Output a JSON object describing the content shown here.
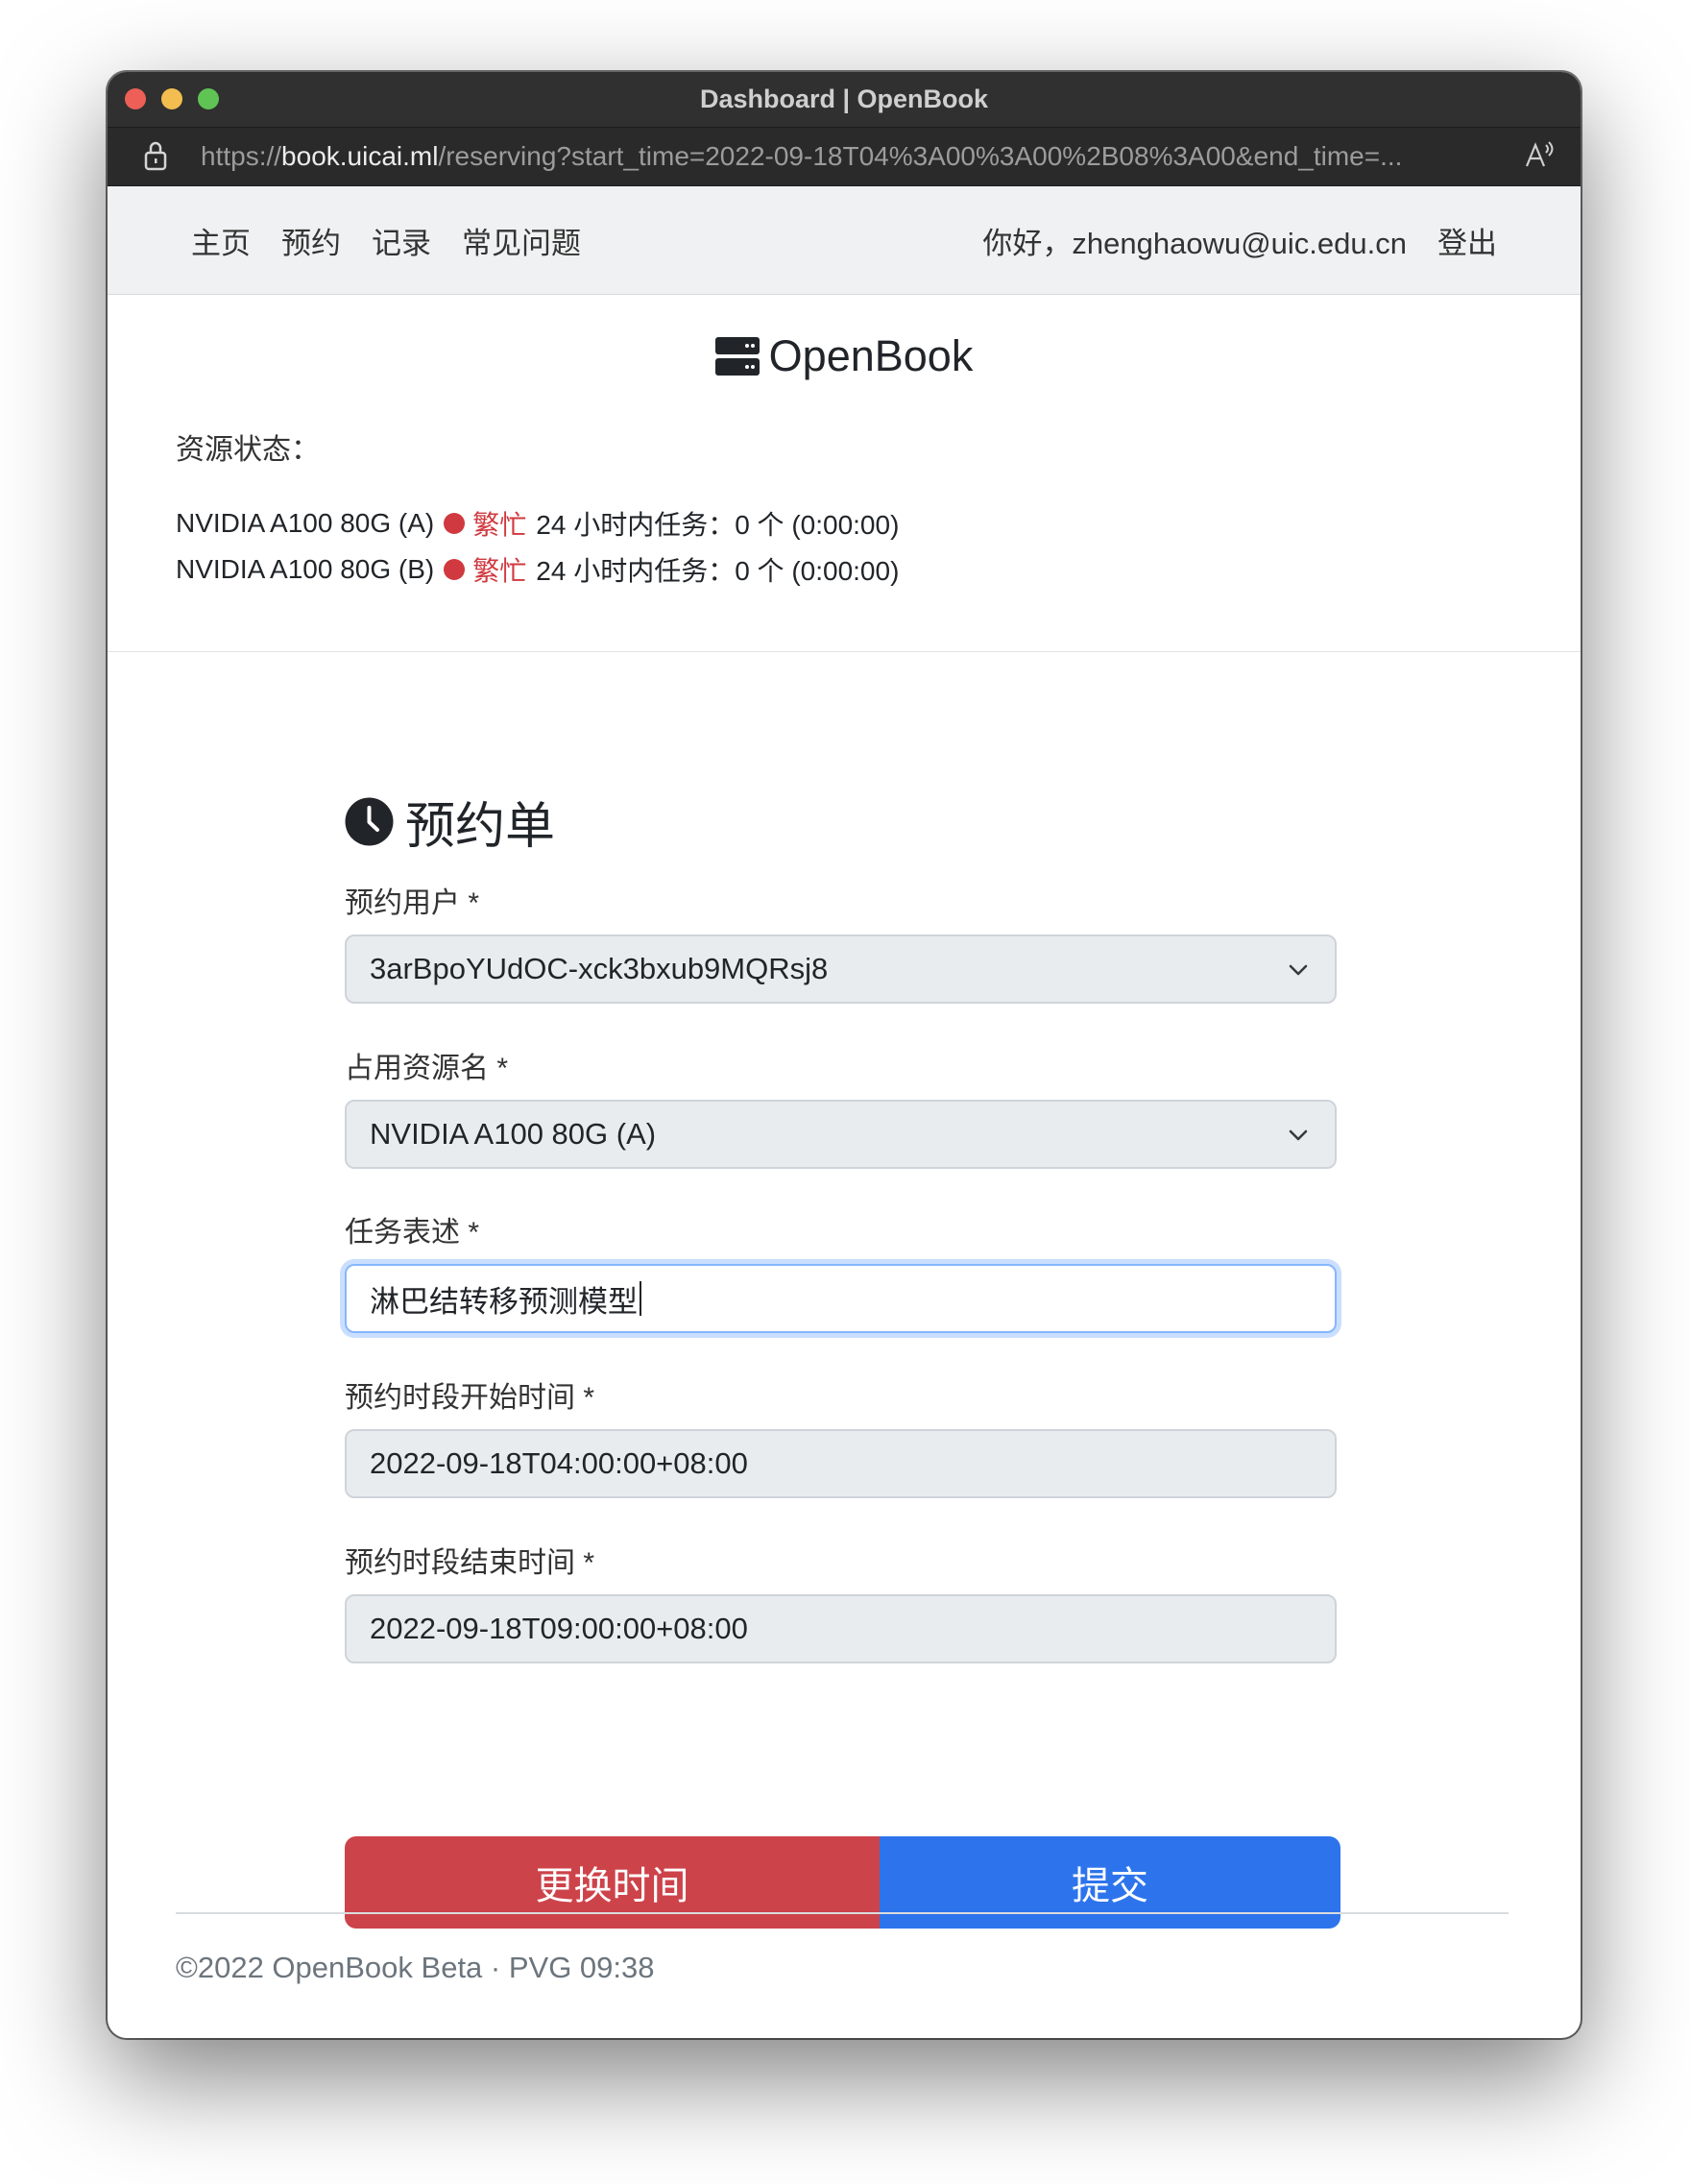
{
  "window": {
    "title": "Dashboard | OpenBook",
    "url_scheme": "https://",
    "url_host": "book.uicai.ml",
    "url_path": "/reserving?start_time=2022-09-18T04%3A00%3A00%2B08%3A00&end_time=..."
  },
  "nav": {
    "links": [
      "主页",
      "预约",
      "记录",
      "常见问题"
    ],
    "greeting": "你好，zhenghaowu@uic.edu.cn",
    "logout": "登出"
  },
  "brand": {
    "name": "OpenBook",
    "icon": "server-icon"
  },
  "status": {
    "title": "资源状态：",
    "resources": [
      {
        "name": "NVIDIA A100 80G (A)",
        "state": "繁忙",
        "tasks": "24 小时内任务：0 个 (0:00:00)"
      },
      {
        "name": "NVIDIA A100 80G (B)",
        "state": "繁忙",
        "tasks": "24 小时内任务：0 个 (0:00:00)"
      }
    ]
  },
  "form": {
    "title": "预约单",
    "user_label": "预约用户 *",
    "user_value": "3arBpoYUdOC-xck3bxub9MQRsj8",
    "resource_label": "占用资源名 *",
    "resource_value": "NVIDIA A100 80G (A)",
    "task_label": "任务表述 *",
    "task_value": "淋巴结转移预测模型",
    "start_label": "预约时段开始时间 *",
    "start_value": "2022-09-18T04:00:00+08:00",
    "end_label": "预约时段结束时间 *",
    "end_value": "2022-09-18T09:00:00+08:00",
    "change_time_button": "更换时间",
    "submit_button": "提交"
  },
  "footer": {
    "text": "©2022 OpenBook Beta · PVG 09:38"
  },
  "colors": {
    "busy": "#d0393f",
    "danger": "#cd434a",
    "primary": "#2d74ec"
  }
}
